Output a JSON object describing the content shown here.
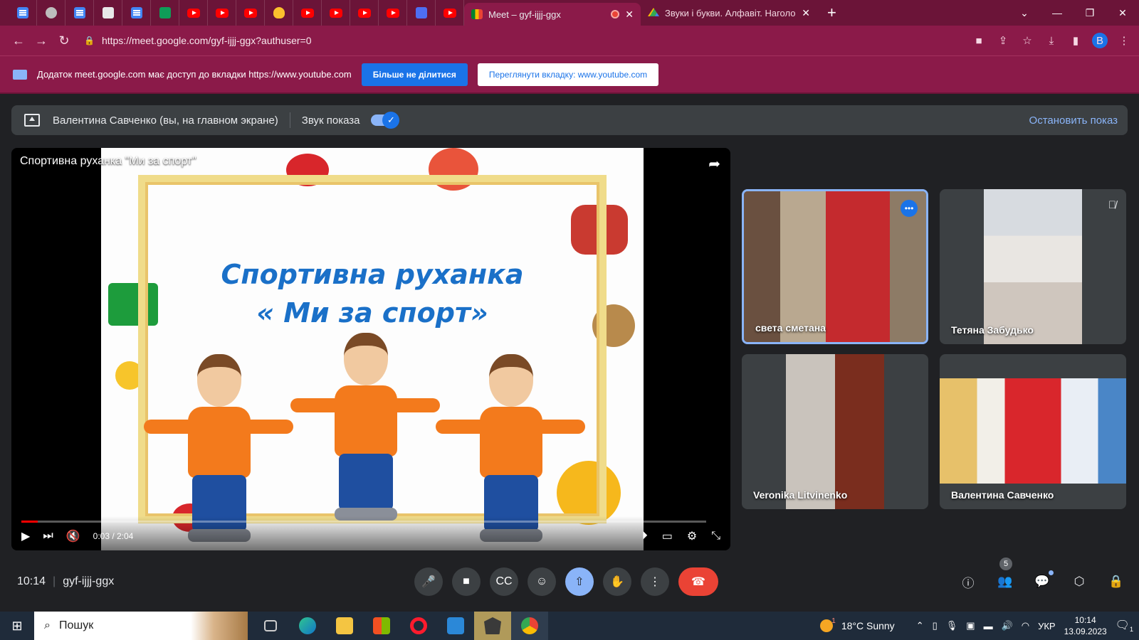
{
  "browser": {
    "pinned_tabs": [
      {
        "icon": "docs-icon"
      },
      {
        "icon": "globe-icon"
      },
      {
        "icon": "docs-icon"
      },
      {
        "icon": "classroom-icon"
      },
      {
        "icon": "docs-icon"
      },
      {
        "icon": "sheets-icon"
      },
      {
        "icon": "youtube-icon"
      },
      {
        "icon": "youtube-icon"
      },
      {
        "icon": "youtube-icon"
      },
      {
        "icon": "bulb-icon"
      },
      {
        "icon": "youtube-icon"
      },
      {
        "icon": "youtube-icon"
      },
      {
        "icon": "youtube-icon"
      },
      {
        "icon": "youtube-icon"
      },
      {
        "icon": "slides-icon"
      },
      {
        "icon": "youtube-icon"
      }
    ],
    "active_tab_title": "Meet – gyf-ijjj-ggx",
    "second_tab_title": "Звуки і букви. Алфавіт. Наголо",
    "address": "https://meet.google.com/gyf-ijjj-ggx?authuser=0",
    "profile_initial": "В"
  },
  "infobar": {
    "message": "Додаток meet.google.com має доступ до вкладки https://www.youtube.com",
    "stop_sharing_button": "Більше не ділитися",
    "view_tab_button": "Переглянути вкладку: www.youtube.com"
  },
  "presenting": {
    "presenter": "Валентина Савченко (вы, на главном экране)",
    "audio_label": "Звук показа",
    "audio_on": true,
    "stop_label": "Остановить показ"
  },
  "video": {
    "title": "Спортивна руханка \"Ми за спорт\"",
    "slide_line1": "Спортивна руханка",
    "slide_line2": "« Ми за спорт»",
    "time": "0:03 / 2:04",
    "progress": 0.024
  },
  "participants": [
    {
      "name": "света сметана",
      "speaking": true
    },
    {
      "name": "Тетяна Забудько",
      "muted": true
    },
    {
      "name": "Veronika Litvinenko"
    },
    {
      "name": "Валентина Савченко"
    }
  ],
  "meet_bar": {
    "time": "10:14",
    "meeting_code": "gyf-ijjj-ggx",
    "people_count": "5"
  },
  "taskbar": {
    "search_placeholder": "Пошук",
    "weather": "18°C  Sunny",
    "weather_badge": "1",
    "language": "УКР",
    "clock_time": "10:14",
    "clock_date": "13.09.2023",
    "notification_count": "1"
  },
  "colors": {
    "chrome_frame": "#6b1438",
    "chrome_toolbar": "#8b1a49",
    "meet_bg": "#202124",
    "accent_blue": "#1a73e8",
    "hangup_red": "#ea4335"
  }
}
